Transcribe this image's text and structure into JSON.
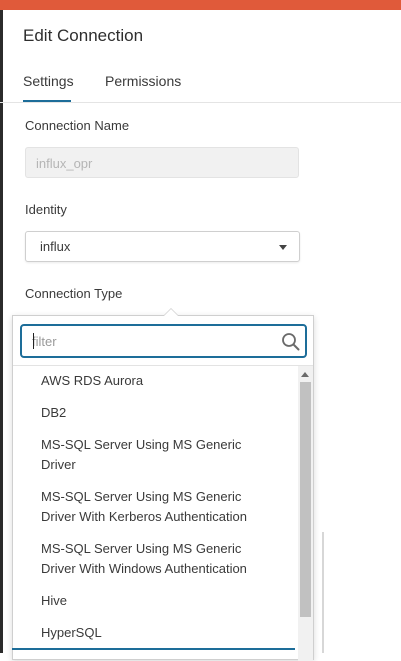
{
  "colors": {
    "top_bar": "#e05a3a",
    "tab_active": "#1d6d99",
    "focus": "#1d6d99",
    "text": "#3a3a3a"
  },
  "dialog": {
    "title": "Edit Connection",
    "tabs": [
      {
        "label": "Settings",
        "active": true
      },
      {
        "label": "Permissions",
        "active": false
      }
    ]
  },
  "form": {
    "connection_name": {
      "label": "Connection Name",
      "value": "influx_opr"
    },
    "identity": {
      "label": "Identity",
      "value": "influx"
    },
    "connection_type": {
      "label": "Connection Type"
    }
  },
  "dropdown": {
    "filter_placeholder": "filter",
    "search_icon": "search-icon",
    "options": [
      {
        "label": "AWS RDS Aurora"
      },
      {
        "label": "DB2"
      },
      {
        "line1": "MS-SQL Server Using MS Generic",
        "line2": "Driver"
      },
      {
        "line1": "MS-SQL Server Using MS Generic",
        "line2": "Driver With Kerberos Authentication"
      },
      {
        "line1": "MS-SQL Server Using MS Generic",
        "line2": "Driver With Windows Authentication"
      },
      {
        "label": "Hive"
      },
      {
        "label": "HyperSQL"
      }
    ]
  }
}
